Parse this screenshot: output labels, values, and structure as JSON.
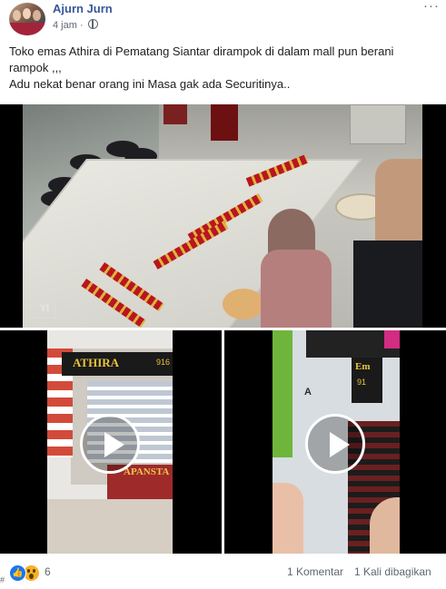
{
  "post": {
    "author": "Ajurn Jurn",
    "time": "4 jam",
    "text_line1": "Toko emas Athira di Pematang Siantar dirampok di dalam mall pun berani",
    "text_line2": "rampok ,,,",
    "text_line3": "Adu nekat benar orang ini Masa gak ada Securitinya.."
  },
  "icons": {
    "more": "more-options-icon",
    "privacy": "globe-icon",
    "play": "play-icon"
  },
  "media": {
    "watermark": "Yl",
    "video1_sign": "ATHIRA",
    "video1_sign_num": "916",
    "video1_banner": "APANSTA",
    "video2_sign": "Em",
    "video2_sign_num": "91",
    "video2_left_sign": "A"
  },
  "footer": {
    "reaction_count": "6",
    "comments": "1 Komentar",
    "shares": "1 Kali dibagikan",
    "hash": "#"
  },
  "colors": {
    "author": "#385898",
    "like": "#1877f2",
    "wow": "#f7b125",
    "meta": "#606770"
  }
}
